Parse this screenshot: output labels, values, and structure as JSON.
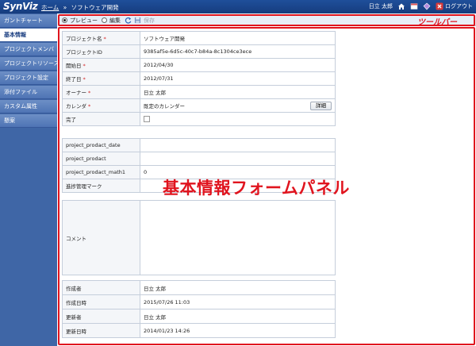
{
  "header": {
    "logo": "SynViz",
    "breadcrumb_home": "ホーム",
    "breadcrumb_sep": "»",
    "breadcrumb_current": "ソフトウェア開発",
    "user_name": "日立 太郎",
    "logout_label": "ログアウト"
  },
  "sidebar": {
    "items": [
      {
        "label": "ガントチャート",
        "active": false
      },
      {
        "label": "基本情報",
        "active": true
      },
      {
        "label": "プロジェクトメンバ",
        "active": false
      },
      {
        "label": "プロジェクトリソース",
        "active": false
      },
      {
        "label": "プロジェクト設定",
        "active": false
      },
      {
        "label": "添付ファイル",
        "active": false
      },
      {
        "label": "カスタム属性",
        "active": false
      },
      {
        "label": "懸案",
        "active": false
      }
    ]
  },
  "toolbar": {
    "preview_label": "プレビュー",
    "edit_label": "編集",
    "save_label": "保存"
  },
  "annotations": {
    "toolbar_label": "ツールバー",
    "panel_label": "基本情報フォームパネル"
  },
  "basic": {
    "project_name_label": "プロジェクト名",
    "project_name_value": "ソフトウェア開発",
    "project_id_label": "プロジェクトID",
    "project_id_value": "9385af5e-6d5c-40c7-b84a-8c1304ce3ece",
    "start_date_label": "開始日",
    "start_date_value": "2012/04/30",
    "end_date_label": "終了日",
    "end_date_value": "2012/07/31",
    "owner_label": "オーナー",
    "owner_value": "日立 太郎",
    "calendar_label": "カレンダ",
    "calendar_value": "既定のカレンダー",
    "detail_button": "詳細",
    "complete_label": "完了",
    "required_mark": "*"
  },
  "custom": {
    "fields": [
      {
        "label": "project_prodact_date",
        "value": ""
      },
      {
        "label": "project_prodact",
        "value": ""
      },
      {
        "label": "project_prodact_math1",
        "value": "0"
      },
      {
        "label": "進捗管理マーク",
        "value": ""
      }
    ]
  },
  "comment": {
    "label": "コメント",
    "value": ""
  },
  "audit": {
    "created_by_label": "作成者",
    "created_by_value": "日立 太郎",
    "created_at_label": "作成日時",
    "created_at_value": "2015/07/26 11:03",
    "updated_by_label": "更新者",
    "updated_by_value": "日立 太郎",
    "updated_at_label": "更新日時",
    "updated_at_value": "2014/01/23 14:26"
  }
}
